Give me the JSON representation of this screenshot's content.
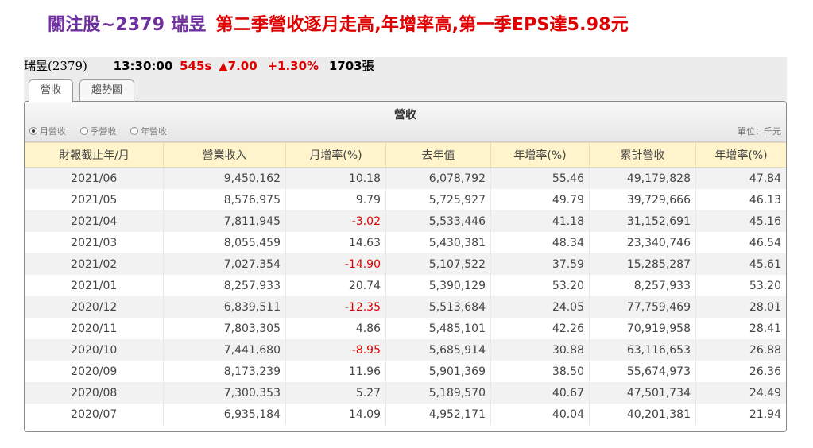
{
  "headline": {
    "part1": "關注股~2379 瑞昱",
    "part2": "第二季營收逐月走高,年增率高,第一季EPS達5.98元"
  },
  "quote": {
    "name": "瑞昱(2379)",
    "time": "13:30:00",
    "price": "545s",
    "change": "▲7.00",
    "percent": "+1.30%",
    "volume": "1703張"
  },
  "tabs": [
    {
      "label": "營收",
      "active": true
    },
    {
      "label": "趨勢圖",
      "active": false
    }
  ],
  "panel": {
    "title": "營收",
    "radios": [
      {
        "label": "月營收",
        "selected": true
      },
      {
        "label": "季營收",
        "selected": false
      },
      {
        "label": "年營收",
        "selected": false
      }
    ],
    "unit": "單位：千元"
  },
  "table": {
    "headers": [
      "財報截止年/月",
      "營業收入",
      "月增率(%)",
      "去年值",
      "年增率(%)",
      "累計營收",
      "年增率(%)"
    ],
    "rows": [
      [
        "2021/06",
        "9,450,162",
        "10.18",
        "6,078,792",
        "55.46",
        "49,179,828",
        "47.84"
      ],
      [
        "2021/05",
        "8,576,975",
        "9.79",
        "5,725,927",
        "49.79",
        "39,729,666",
        "46.13"
      ],
      [
        "2021/04",
        "7,811,945",
        "-3.02",
        "5,533,446",
        "41.18",
        "31,152,691",
        "45.16"
      ],
      [
        "2021/03",
        "8,055,459",
        "14.63",
        "5,430,381",
        "48.34",
        "23,340,746",
        "46.54"
      ],
      [
        "2021/02",
        "7,027,354",
        "-14.90",
        "5,107,522",
        "37.59",
        "15,285,287",
        "45.61"
      ],
      [
        "2021/01",
        "8,257,933",
        "20.74",
        "5,390,129",
        "53.20",
        "8,257,933",
        "53.20"
      ],
      [
        "2020/12",
        "6,839,511",
        "-12.35",
        "5,513,684",
        "24.05",
        "77,759,469",
        "28.01"
      ],
      [
        "2020/11",
        "7,803,305",
        "4.86",
        "5,485,101",
        "42.26",
        "70,919,958",
        "28.41"
      ],
      [
        "2020/10",
        "7,441,680",
        "-8.95",
        "5,685,914",
        "30.88",
        "63,116,653",
        "26.88"
      ],
      [
        "2020/09",
        "8,173,239",
        "11.96",
        "5,901,369",
        "38.50",
        "55,674,973",
        "26.36"
      ],
      [
        "2020/08",
        "7,300,353",
        "5.27",
        "5,189,570",
        "40.67",
        "47,501,734",
        "24.49"
      ],
      [
        "2020/07",
        "6,935,184",
        "14.09",
        "4,952,171",
        "40.04",
        "40,201,381",
        "21.94"
      ]
    ]
  },
  "colors": {
    "headline_purple": "#7030a0",
    "accent_red": "#e00000",
    "header_bg": "#fff4cc"
  }
}
